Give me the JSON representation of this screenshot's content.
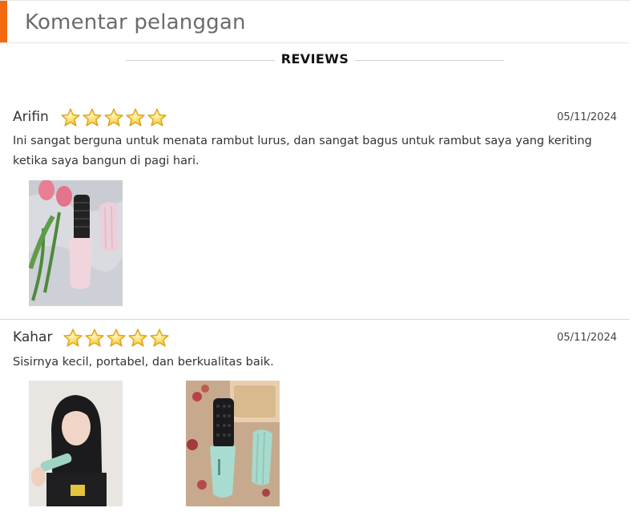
{
  "header": {
    "title": "Komentar pelanggan",
    "accent_color": "#f26a10"
  },
  "reviews_label": "REVIEWS",
  "reviews": [
    {
      "name": "Arifin",
      "rating": 5,
      "date": "05/11/2024",
      "text": "Ini sangat berguna untuk menata rambut lurus, dan sangat bagus untuk rambut saya yang keriting ketika saya bangun di pagi hari.",
      "photos": [
        "pink-hair-brush-with-tulips-photo"
      ]
    },
    {
      "name": "Kahar",
      "rating": 5,
      "date": "05/11/2024",
      "text": "Sisirnya kecil, portabel, dan berkualitas baik.",
      "photos": [
        "woman-using-hair-brush-photo",
        "mint-hair-brush-with-flowers-photo"
      ]
    }
  ],
  "colors": {
    "star_fill": "#f7d04a",
    "star_stroke": "#d9a21b"
  }
}
